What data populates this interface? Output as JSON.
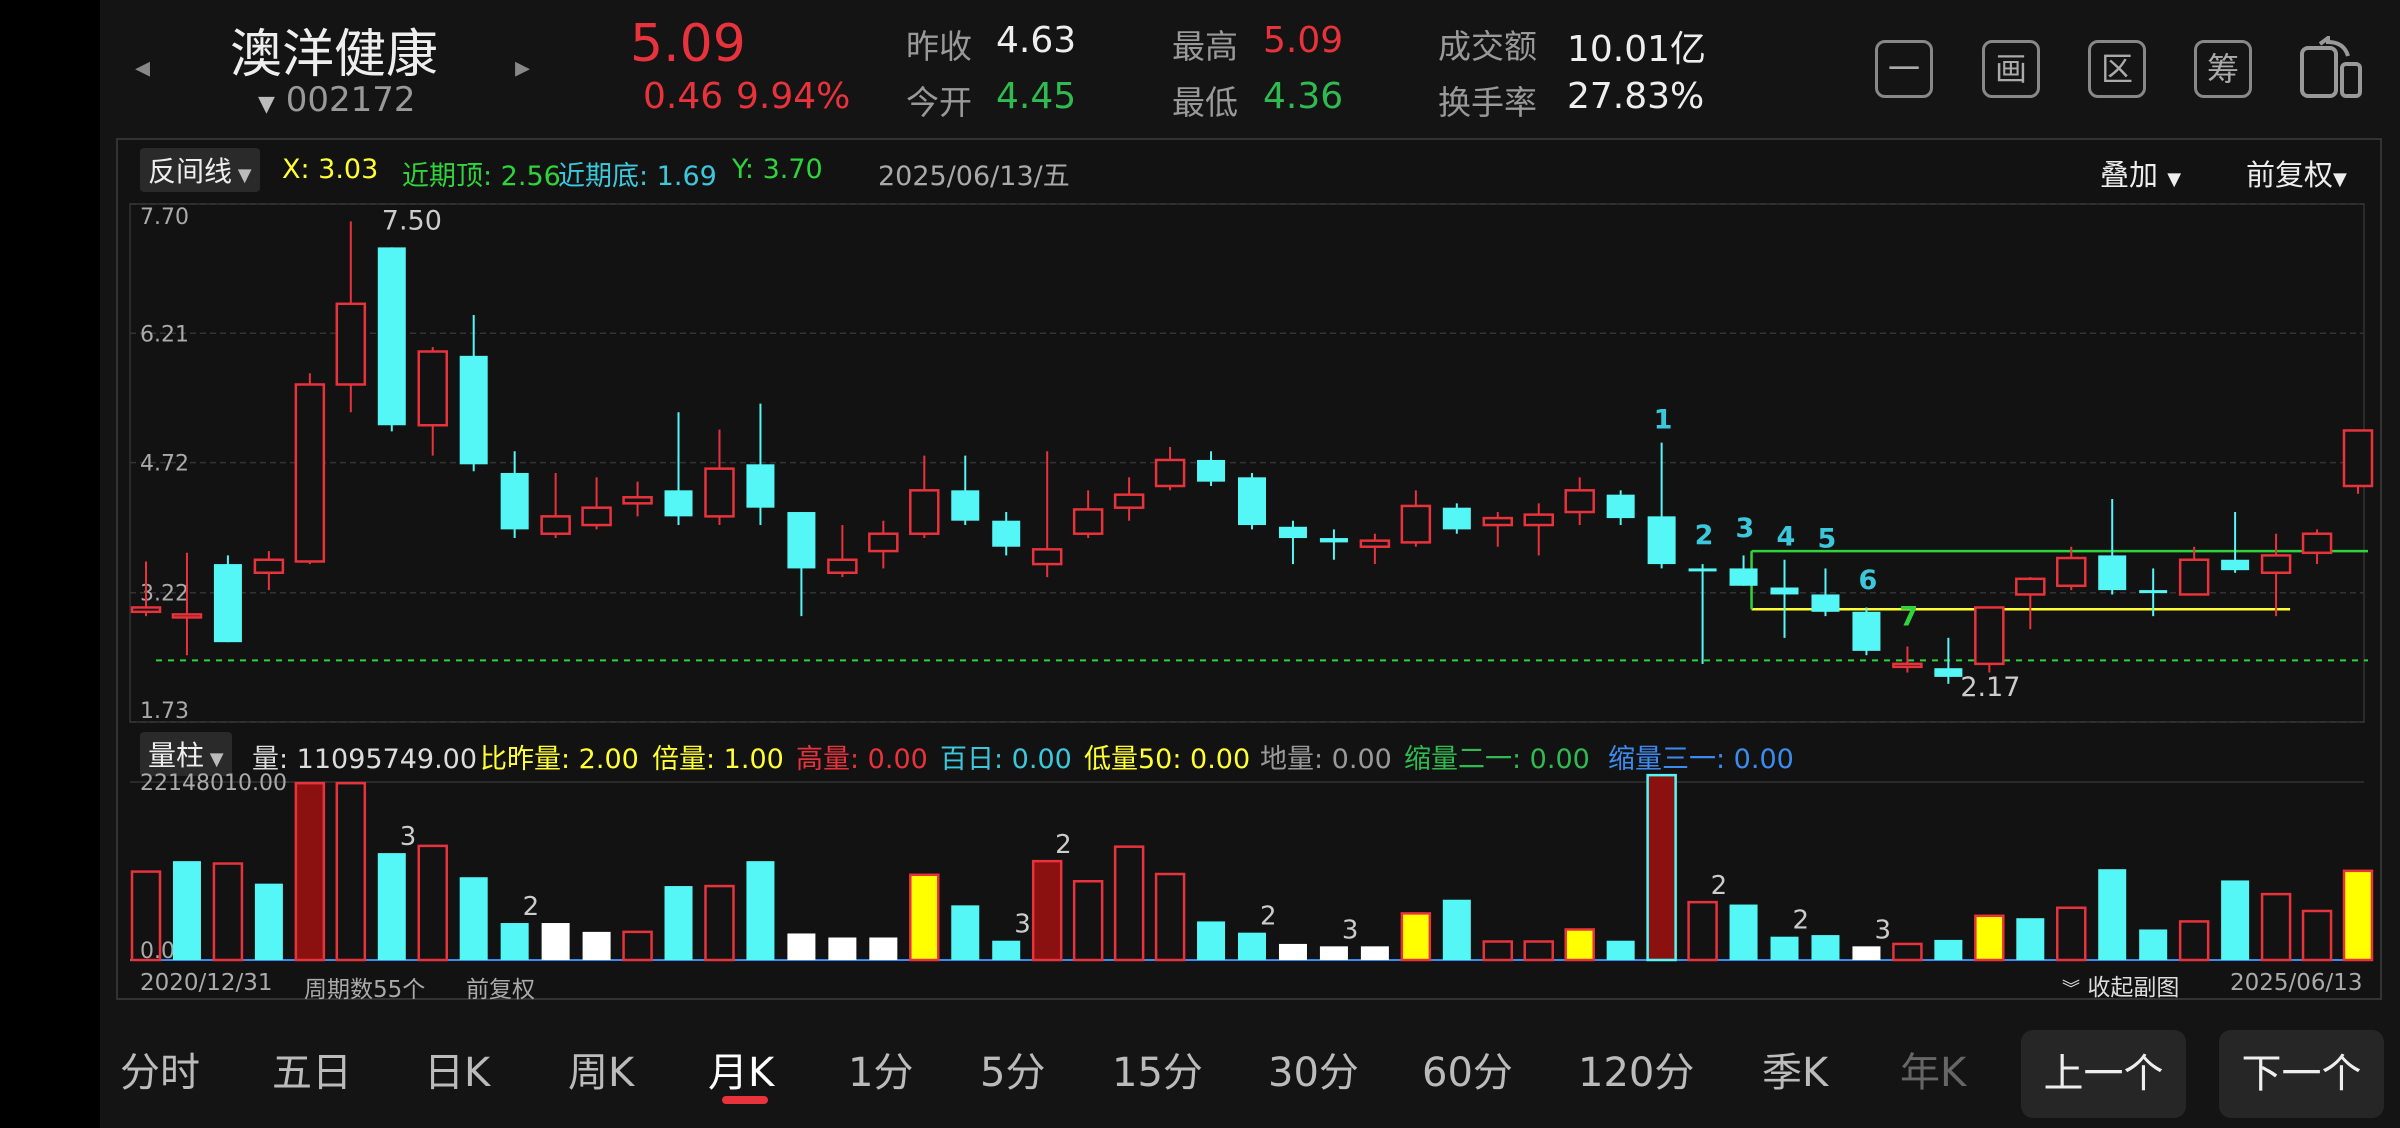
{
  "header": {
    "stock_name": "澳洋健康",
    "stock_code": "002172",
    "price": "5.09",
    "change": "0.46",
    "change_pct": "9.94%",
    "prev_close_label": "昨收",
    "prev_close": "4.63",
    "open_label": "今开",
    "open": "4.45",
    "high_label": "最高",
    "high": "5.09",
    "low_label": "最低",
    "low": "4.36",
    "amount_label": "成交额",
    "amount": "10.01亿",
    "turnover_label": "换手率",
    "turnover": "27.83%",
    "icons": [
      "一",
      "画",
      "区",
      "筹",
      "share-icon"
    ]
  },
  "indicator": {
    "name": "反间线",
    "x": "X: 3.03",
    "recent_top": "近期顶: 2.56",
    "recent_bottom": "近期底: 1.69",
    "y": "Y: 3.70",
    "date": "2025/06/13/五",
    "overlay_label": "叠加",
    "adjust_label": "前复权"
  },
  "volume_indicator": {
    "name": "量柱",
    "vol": "量: 11095749.00",
    "ratio_prev": "比昨量: 2.00",
    "multiple": "倍量: 1.00",
    "high_vol": "高量: 0.00",
    "hundred_day": "百日: 0.00",
    "low_vol": "低量50: 0.00",
    "ground_vol": "地量: 0.00",
    "shrink21": "缩量二一: 0.00",
    "shrink31": "缩量三一: 0.00",
    "vol_max_label": "22148010.00",
    "vol_min_label": "0.00"
  },
  "footer_info": {
    "start_date": "2020/12/31",
    "periods": "周期数55个",
    "adjust": "前复权",
    "collapse": "收起副图",
    "end_date": "2025/06/13"
  },
  "tabs": [
    "分时",
    "五日",
    "日K",
    "周K",
    "月K",
    "1分",
    "5分",
    "15分",
    "30分",
    "60分",
    "120分",
    "季K",
    "年K"
  ],
  "active_tab": "月K",
  "prev_button": "上一个",
  "next_button": "下一个",
  "colors": {
    "up": "#e8323c",
    "down": "#55f6f6",
    "ma": "#ffffff",
    "yellow": "#ffff33",
    "green_line": "#2fd43c",
    "dark_red": "#8b1010"
  },
  "chart_data": {
    "type": "candlestick",
    "y_ticks": [
      "7.70",
      "6.21",
      "4.72",
      "3.22",
      "1.73"
    ],
    "ylim": [
      1.73,
      7.7
    ],
    "price_labels": [
      "7.50",
      "2.17"
    ],
    "wave_labels": [
      "1",
      "2",
      "3",
      "4",
      "5",
      "6",
      "7"
    ],
    "support_lines": [
      {
        "name": "X",
        "value": 3.03
      },
      {
        "name": "Y",
        "value": 3.7
      },
      {
        "name": "near-bottom",
        "value": 2.44
      }
    ],
    "candles": [
      [
        3.0,
        3.05,
        3.58,
        2.95
      ],
      [
        2.95,
        2.97,
        3.68,
        2.5
      ],
      [
        3.55,
        2.65,
        3.65,
        2.65
      ],
      [
        3.45,
        3.6,
        3.7,
        3.25
      ],
      [
        3.58,
        5.62,
        5.75,
        3.55
      ],
      [
        5.62,
        6.55,
        7.5,
        5.3
      ],
      [
        7.2,
        5.15,
        7.2,
        5.08
      ],
      [
        5.15,
        6.0,
        6.05,
        4.8
      ],
      [
        5.95,
        4.7,
        6.42,
        4.62
      ],
      [
        4.6,
        3.95,
        4.85,
        3.85
      ],
      [
        3.9,
        4.1,
        4.6,
        3.85
      ],
      [
        4.0,
        4.2,
        4.55,
        3.95
      ],
      [
        4.25,
        4.32,
        4.5,
        4.1
      ],
      [
        4.4,
        4.1,
        5.3,
        4.0
      ],
      [
        4.1,
        4.65,
        5.1,
        4.0
      ],
      [
        4.7,
        4.2,
        5.4,
        4.0
      ],
      [
        4.15,
        3.5,
        4.15,
        2.95
      ],
      [
        3.45,
        3.6,
        4.0,
        3.4
      ],
      [
        3.7,
        3.9,
        4.05,
        3.5
      ],
      [
        3.9,
        4.4,
        4.8,
        3.85
      ],
      [
        4.4,
        4.05,
        4.8,
        4.0
      ],
      [
        4.05,
        3.75,
        4.15,
        3.65
      ],
      [
        3.55,
        3.72,
        4.85,
        3.4
      ],
      [
        3.9,
        4.18,
        4.4,
        3.85
      ],
      [
        4.2,
        4.35,
        4.55,
        4.05
      ],
      [
        4.45,
        4.75,
        4.9,
        4.4
      ],
      [
        4.75,
        4.5,
        4.85,
        4.45
      ],
      [
        4.55,
        4.0,
        4.6,
        3.95
      ],
      [
        3.98,
        3.85,
        4.05,
        3.55
      ],
      [
        3.85,
        3.8,
        3.95,
        3.6
      ],
      [
        3.75,
        3.82,
        3.9,
        3.55
      ],
      [
        3.8,
        4.22,
        4.4,
        3.75
      ],
      [
        4.2,
        3.95,
        4.25,
        3.9
      ],
      [
        4.0,
        4.08,
        4.15,
        3.75
      ],
      [
        4.0,
        4.12,
        4.25,
        3.65
      ],
      [
        4.15,
        4.4,
        4.55,
        4.0
      ],
      [
        4.35,
        4.08,
        4.4,
        4.0
      ],
      [
        4.1,
        3.55,
        4.95,
        3.5
      ],
      [
        3.5,
        3.48,
        3.55,
        2.4
      ],
      [
        3.5,
        3.3,
        3.65,
        3.3
      ],
      [
        3.28,
        3.2,
        3.6,
        2.7
      ],
      [
        3.2,
        3.0,
        3.5,
        2.95
      ],
      [
        3.0,
        2.55,
        3.05,
        2.5
      ],
      [
        2.38,
        2.4,
        2.6,
        2.3
      ],
      [
        2.35,
        2.25,
        2.7,
        2.17
      ],
      [
        2.4,
        3.05,
        3.05,
        2.3
      ],
      [
        3.2,
        3.38,
        3.4,
        2.8
      ],
      [
        3.3,
        3.62,
        3.75,
        3.25
      ],
      [
        3.65,
        3.25,
        4.3,
        3.2
      ],
      [
        3.25,
        3.22,
        3.5,
        2.95
      ],
      [
        3.2,
        3.6,
        3.75,
        3.2
      ],
      [
        3.6,
        3.48,
        4.15,
        3.45
      ],
      [
        3.45,
        3.65,
        3.9,
        2.95
      ],
      [
        3.68,
        3.9,
        3.95,
        3.55
      ],
      [
        4.45,
        5.09,
        5.09,
        4.36
      ]
    ],
    "volume": {
      "max": 22148010,
      "values": [
        11000000,
        12300000,
        12000000,
        9500000,
        22000000,
        22000000,
        13300000,
        14200000,
        10300000,
        4600000,
        4600000,
        3500000,
        3500000,
        9200000,
        9200000,
        12300000,
        3300000,
        2800000,
        2800000,
        10600000,
        6800000,
        2400000,
        12300000,
        9800000,
        14100000,
        10700000,
        4800000,
        3400000,
        2000000,
        1700000,
        1700000,
        5800000,
        7500000,
        2300000,
        2300000,
        3800000,
        2400000,
        23000000,
        7200000,
        6900000,
        2900000,
        3100000,
        1700000,
        2000000,
        2500000,
        5500000,
        5200000,
        6500000,
        11300000,
        3800000,
        4800000,
        9900000,
        8200000,
        6100000,
        11095749
      ],
      "colors": [
        "r",
        "c",
        "r",
        "c",
        "dr",
        "r",
        "c",
        "r",
        "c",
        "c",
        "w",
        "w",
        "r",
        "c",
        "r",
        "c",
        "w",
        "w",
        "w",
        "y",
        "c",
        "c",
        "dr",
        "r",
        "r",
        "r",
        "c",
        "c",
        "w",
        "w",
        "w",
        "y",
        "c",
        "r",
        "r",
        "y",
        "c",
        "dr",
        "r",
        "c",
        "c",
        "c",
        "w",
        "r",
        "c",
        "y",
        "c",
        "r",
        "c",
        "c",
        "r",
        "c",
        "r",
        "r",
        "y"
      ],
      "labels": {
        "6": "3",
        "9": "2",
        "21": "3",
        "22": "2",
        "27": "2",
        "29": "3",
        "38": "2",
        "40": "2",
        "42": "3"
      }
    }
  }
}
